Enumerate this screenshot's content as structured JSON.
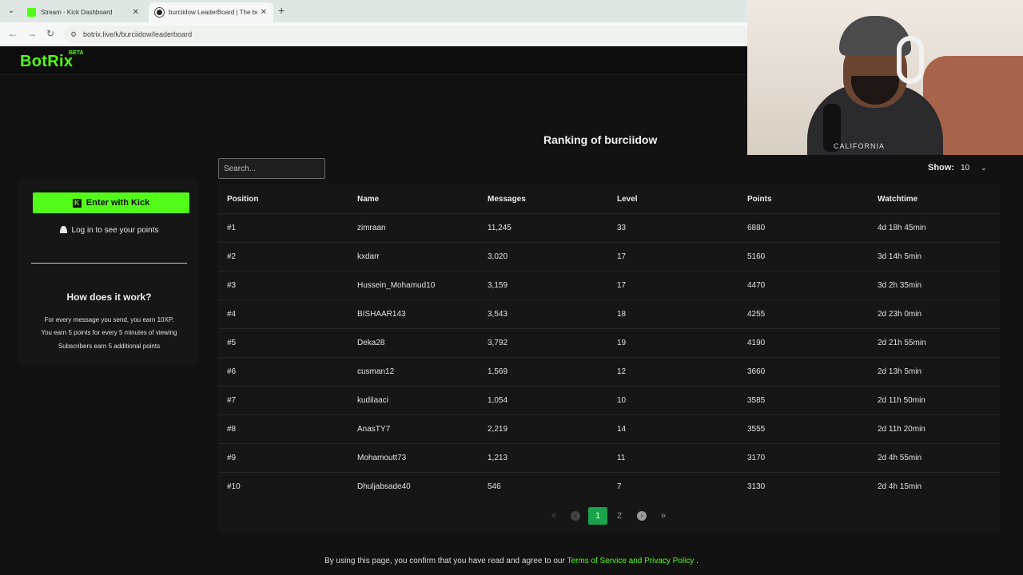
{
  "browser": {
    "tabs": [
      {
        "title": "Stream - Kick Dashboard",
        "active": false
      },
      {
        "title": "burciidow LeaderBoard | The be",
        "active": true
      }
    ],
    "url": "botrix.live/k/burciidow/leaderboard"
  },
  "site": {
    "logo": "BotRix",
    "badge": "BETA"
  },
  "webcam": {
    "shirt_text": "CALIFORNIA"
  },
  "sidebar": {
    "kick_button": "Enter with Kick",
    "login_text": "Log in to see your points",
    "how_title": "How does it work?",
    "how_lines": [
      "For every message you send, you earn 10XP.",
      "You earn 5 points for every 5 minutes of viewing",
      "Subscribers earn 5 additional points"
    ]
  },
  "main": {
    "title": "Ranking of burciidow",
    "search_placeholder": "Search...",
    "show_label": "Show:",
    "show_value": "10",
    "columns": [
      "Position",
      "Name",
      "Messages",
      "Level",
      "Points",
      "Watchtime"
    ],
    "rows": [
      {
        "position": "#1",
        "name": "zimraan",
        "messages": "11,245",
        "level": "33",
        "points": "6880",
        "watchtime": "4d 18h 45min"
      },
      {
        "position": "#2",
        "name": "kxdarr",
        "messages": "3,020",
        "level": "17",
        "points": "5160",
        "watchtime": "3d 14h 5min"
      },
      {
        "position": "#3",
        "name": "Hussein_Mohamud10",
        "messages": "3,159",
        "level": "17",
        "points": "4470",
        "watchtime": "3d 2h 35min"
      },
      {
        "position": "#4",
        "name": "BISHAAR143",
        "messages": "3,543",
        "level": "18",
        "points": "4255",
        "watchtime": "2d 23h 0min"
      },
      {
        "position": "#5",
        "name": "Deka28",
        "messages": "3,792",
        "level": "19",
        "points": "4190",
        "watchtime": "2d 21h 55min"
      },
      {
        "position": "#6",
        "name": "cusman12",
        "messages": "1,569",
        "level": "12",
        "points": "3660",
        "watchtime": "2d 13h 5min"
      },
      {
        "position": "#7",
        "name": "kudilaaci",
        "messages": "1,054",
        "level": "10",
        "points": "3585",
        "watchtime": "2d 11h 50min"
      },
      {
        "position": "#8",
        "name": "AnasTY7",
        "messages": "2,219",
        "level": "14",
        "points": "3555",
        "watchtime": "2d 11h 20min"
      },
      {
        "position": "#9",
        "name": "Mohamoutt73",
        "messages": "1,213",
        "level": "11",
        "points": "3170",
        "watchtime": "2d 4h 55min"
      },
      {
        "position": "#10",
        "name": "Dhuljabsade40",
        "messages": "546",
        "level": "7",
        "points": "3130",
        "watchtime": "2d 4h 15min"
      }
    ],
    "pagination": {
      "first": "«",
      "prev": "‹",
      "pages": [
        "1",
        "2"
      ],
      "current": "1",
      "next": "›",
      "last": "»"
    }
  },
  "footer": {
    "text": "By using this page, you confirm that you have read and agree to our",
    "link": "Terms of Service and Privacy Policy",
    "end": "."
  },
  "colors": {
    "accent": "#53fc18",
    "active_page": "#1aa34a",
    "background": "#121212"
  }
}
